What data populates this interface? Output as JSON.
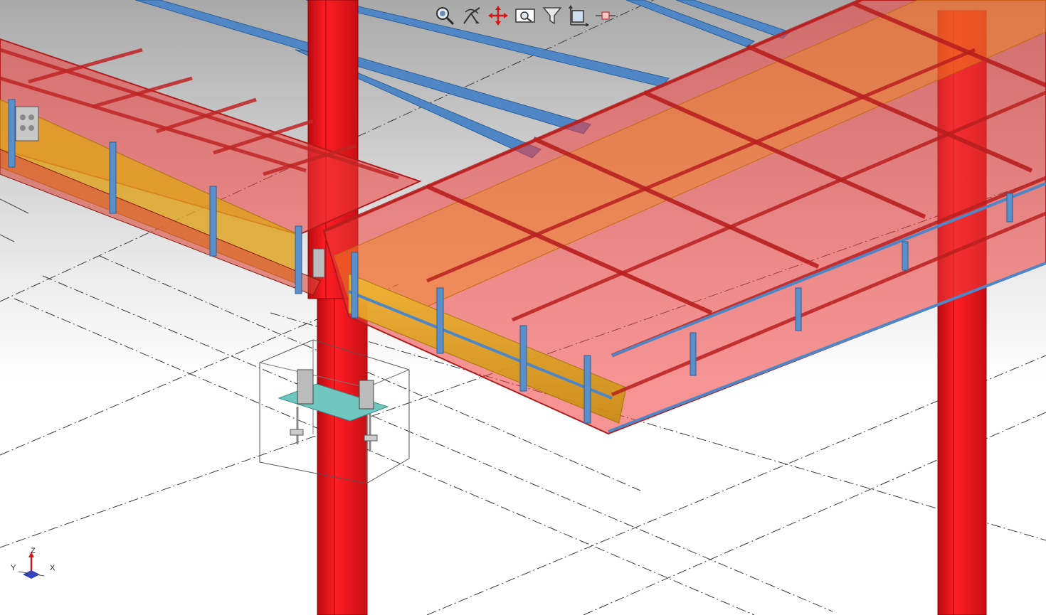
{
  "viewport": {
    "name": "3d-model-view"
  },
  "toolbar": {
    "tools": [
      {
        "id": "zoom",
        "icon": "zoom-magnifier-icon"
      },
      {
        "id": "rotate",
        "icon": "rotate-axes-icon"
      },
      {
        "id": "pan",
        "icon": "pan-arrows-icon"
      },
      {
        "id": "zoom-window",
        "icon": "zoom-window-icon"
      },
      {
        "id": "filter",
        "icon": "filter-funnel-icon"
      },
      {
        "id": "clip-plane",
        "icon": "clip-plane-icon"
      },
      {
        "id": "snap",
        "icon": "snap-point-icon"
      }
    ]
  },
  "axis_triad": {
    "x": "X",
    "y": "Y",
    "z": "Z"
  },
  "colors": {
    "columns": "#e8141a",
    "roof_purlins": "#4f86c6",
    "platform_transparent": "#ee3b3b",
    "main_beams": "#e0a21b",
    "grid_lines": "#333333",
    "background_top": "#a9a9a9",
    "background_bottom": "#ffffff"
  }
}
